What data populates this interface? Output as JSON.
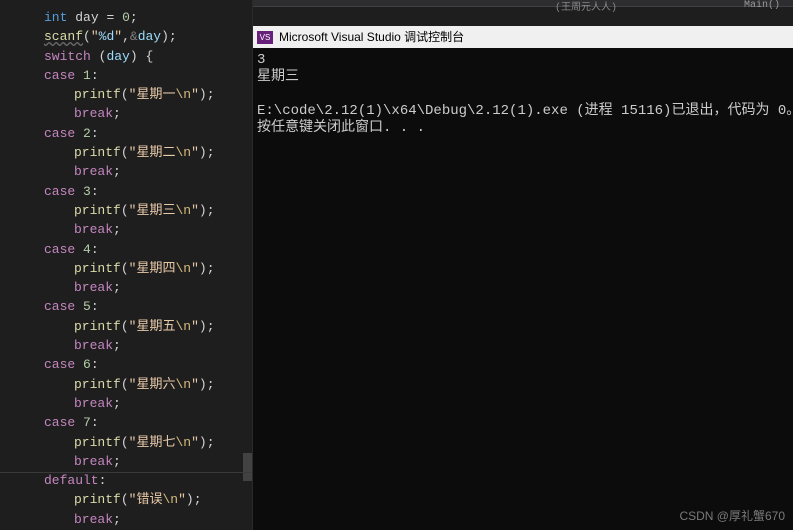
{
  "topBar": {
    "leftTag": "(王周元人人)",
    "rightLabel": "Main()"
  },
  "consoleWindow": {
    "title": "Microsoft Visual Studio 调试控制台",
    "badge": "VS"
  },
  "consoleOutput": {
    "l1": "3",
    "l2": "星期三",
    "l3": "",
    "l4": "E:\\code\\2.12(1)\\x64\\Debug\\2.12(1).exe (进程 15116)已退出，代码为 0。",
    "l5": "按任意键关闭此窗口. . ."
  },
  "code": {
    "l1": {
      "int": "int",
      "day": "day",
      "eq": "=",
      "zero": "0",
      "semi": ";"
    },
    "l2": {
      "scanf": "scanf",
      "open": "(",
      "q1": "\"",
      "fmt": "%d",
      "q2": "\"",
      "comma": ",",
      "amp": "&",
      "day": "day",
      "close": ")",
      "semi": ";"
    },
    "l3": {
      "switch": "switch",
      "open": "(",
      "day": "day",
      "close": ")",
      "brace": "{"
    },
    "l4": {
      "case": "case",
      "n": "1",
      "colon": ":"
    },
    "l5": {
      "printf": "printf",
      "open": "(",
      "q1": "\"",
      "txt": "星期一",
      "esc": "\\n",
      "q2": "\"",
      "close": ")",
      "semi": ";"
    },
    "l6": {
      "break": "break",
      "semi": ";"
    },
    "l7": {
      "case": "case",
      "n": "2",
      "colon": ":"
    },
    "l8": {
      "printf": "printf",
      "open": "(",
      "q1": "\"",
      "txt": "星期二",
      "esc": "\\n",
      "q2": "\"",
      "close": ")",
      "semi": ";"
    },
    "l9": {
      "break": "break",
      "semi": ";"
    },
    "l10": {
      "case": "case",
      "n": "3",
      "colon": ":"
    },
    "l11": {
      "printf": "printf",
      "open": "(",
      "q1": "\"",
      "txt": "星期三",
      "esc": "\\n",
      "q2": "\"",
      "close": ")",
      "semi": ";"
    },
    "l12": {
      "break": "break",
      "semi": ";"
    },
    "l13": {
      "case": "case",
      "n": "4",
      "colon": ":"
    },
    "l14": {
      "printf": "printf",
      "open": "(",
      "q1": "\"",
      "txt": "星期四",
      "esc": "\\n",
      "q2": "\"",
      "close": ")",
      "semi": ";"
    },
    "l15": {
      "break": "break",
      "semi": ";"
    },
    "l16": {
      "case": "case",
      "n": "5",
      "colon": ":"
    },
    "l17": {
      "printf": "printf",
      "open": "(",
      "q1": "\"",
      "txt": "星期五",
      "esc": "\\n",
      "q2": "\"",
      "close": ")",
      "semi": ";"
    },
    "l18": {
      "break": "break",
      "semi": ";"
    },
    "l19": {
      "case": "case",
      "n": "6",
      "colon": ":"
    },
    "l20": {
      "printf": "printf",
      "open": "(",
      "q1": "\"",
      "txt": "星期六",
      "esc": "\\n",
      "q2": "\"",
      "close": ")",
      "semi": ";"
    },
    "l21": {
      "break": "break",
      "semi": ";"
    },
    "l22": {
      "case": "case",
      "n": "7",
      "colon": ":"
    },
    "l23": {
      "printf": "printf",
      "open": "(",
      "q1": "\"",
      "txt": "星期七",
      "esc": "\\n",
      "q2": "\"",
      "close": ")",
      "semi": ";"
    },
    "l24": {
      "break": "break",
      "semi": ";"
    },
    "l25": {
      "default": "default",
      "colon": ":"
    },
    "l26": {
      "printf": "printf",
      "open": "(",
      "q1": "\"",
      "txt": "错误",
      "esc": "\\n",
      "q2": "\"",
      "close": ")",
      "semi": ";"
    },
    "l27": {
      "break": "break",
      "semi": ";"
    }
  },
  "watermark": "CSDN @厚礼蟹670"
}
